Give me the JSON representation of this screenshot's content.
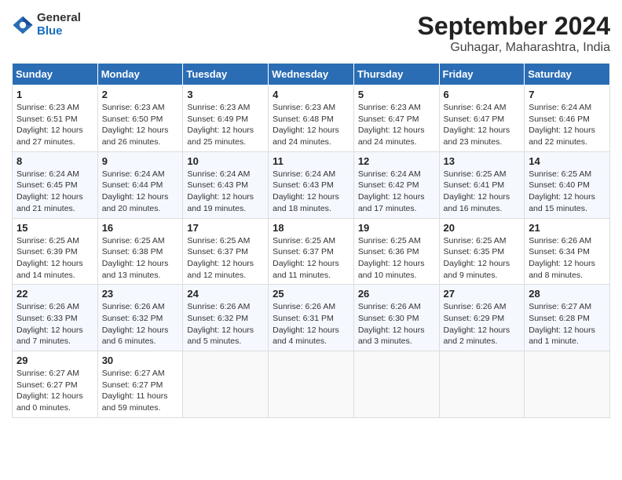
{
  "header": {
    "logo_general": "General",
    "logo_blue": "Blue",
    "main_title": "September 2024",
    "subtitle": "Guhagar, Maharashtra, India"
  },
  "weekdays": [
    "Sunday",
    "Monday",
    "Tuesday",
    "Wednesday",
    "Thursday",
    "Friday",
    "Saturday"
  ],
  "weeks": [
    [
      {
        "day": "1",
        "info": "Sunrise: 6:23 AM\nSunset: 6:51 PM\nDaylight: 12 hours\nand 27 minutes."
      },
      {
        "day": "2",
        "info": "Sunrise: 6:23 AM\nSunset: 6:50 PM\nDaylight: 12 hours\nand 26 minutes."
      },
      {
        "day": "3",
        "info": "Sunrise: 6:23 AM\nSunset: 6:49 PM\nDaylight: 12 hours\nand 25 minutes."
      },
      {
        "day": "4",
        "info": "Sunrise: 6:23 AM\nSunset: 6:48 PM\nDaylight: 12 hours\nand 24 minutes."
      },
      {
        "day": "5",
        "info": "Sunrise: 6:23 AM\nSunset: 6:47 PM\nDaylight: 12 hours\nand 24 minutes."
      },
      {
        "day": "6",
        "info": "Sunrise: 6:24 AM\nSunset: 6:47 PM\nDaylight: 12 hours\nand 23 minutes."
      },
      {
        "day": "7",
        "info": "Sunrise: 6:24 AM\nSunset: 6:46 PM\nDaylight: 12 hours\nand 22 minutes."
      }
    ],
    [
      {
        "day": "8",
        "info": "Sunrise: 6:24 AM\nSunset: 6:45 PM\nDaylight: 12 hours\nand 21 minutes."
      },
      {
        "day": "9",
        "info": "Sunrise: 6:24 AM\nSunset: 6:44 PM\nDaylight: 12 hours\nand 20 minutes."
      },
      {
        "day": "10",
        "info": "Sunrise: 6:24 AM\nSunset: 6:43 PM\nDaylight: 12 hours\nand 19 minutes."
      },
      {
        "day": "11",
        "info": "Sunrise: 6:24 AM\nSunset: 6:43 PM\nDaylight: 12 hours\nand 18 minutes."
      },
      {
        "day": "12",
        "info": "Sunrise: 6:24 AM\nSunset: 6:42 PM\nDaylight: 12 hours\nand 17 minutes."
      },
      {
        "day": "13",
        "info": "Sunrise: 6:25 AM\nSunset: 6:41 PM\nDaylight: 12 hours\nand 16 minutes."
      },
      {
        "day": "14",
        "info": "Sunrise: 6:25 AM\nSunset: 6:40 PM\nDaylight: 12 hours\nand 15 minutes."
      }
    ],
    [
      {
        "day": "15",
        "info": "Sunrise: 6:25 AM\nSunset: 6:39 PM\nDaylight: 12 hours\nand 14 minutes."
      },
      {
        "day": "16",
        "info": "Sunrise: 6:25 AM\nSunset: 6:38 PM\nDaylight: 12 hours\nand 13 minutes."
      },
      {
        "day": "17",
        "info": "Sunrise: 6:25 AM\nSunset: 6:37 PM\nDaylight: 12 hours\nand 12 minutes."
      },
      {
        "day": "18",
        "info": "Sunrise: 6:25 AM\nSunset: 6:37 PM\nDaylight: 12 hours\nand 11 minutes."
      },
      {
        "day": "19",
        "info": "Sunrise: 6:25 AM\nSunset: 6:36 PM\nDaylight: 12 hours\nand 10 minutes."
      },
      {
        "day": "20",
        "info": "Sunrise: 6:25 AM\nSunset: 6:35 PM\nDaylight: 12 hours\nand 9 minutes."
      },
      {
        "day": "21",
        "info": "Sunrise: 6:26 AM\nSunset: 6:34 PM\nDaylight: 12 hours\nand 8 minutes."
      }
    ],
    [
      {
        "day": "22",
        "info": "Sunrise: 6:26 AM\nSunset: 6:33 PM\nDaylight: 12 hours\nand 7 minutes."
      },
      {
        "day": "23",
        "info": "Sunrise: 6:26 AM\nSunset: 6:32 PM\nDaylight: 12 hours\nand 6 minutes."
      },
      {
        "day": "24",
        "info": "Sunrise: 6:26 AM\nSunset: 6:32 PM\nDaylight: 12 hours\nand 5 minutes."
      },
      {
        "day": "25",
        "info": "Sunrise: 6:26 AM\nSunset: 6:31 PM\nDaylight: 12 hours\nand 4 minutes."
      },
      {
        "day": "26",
        "info": "Sunrise: 6:26 AM\nSunset: 6:30 PM\nDaylight: 12 hours\nand 3 minutes."
      },
      {
        "day": "27",
        "info": "Sunrise: 6:26 AM\nSunset: 6:29 PM\nDaylight: 12 hours\nand 2 minutes."
      },
      {
        "day": "28",
        "info": "Sunrise: 6:27 AM\nSunset: 6:28 PM\nDaylight: 12 hours\nand 1 minute."
      }
    ],
    [
      {
        "day": "29",
        "info": "Sunrise: 6:27 AM\nSunset: 6:27 PM\nDaylight: 12 hours\nand 0 minutes."
      },
      {
        "day": "30",
        "info": "Sunrise: 6:27 AM\nSunset: 6:27 PM\nDaylight: 11 hours\nand 59 minutes."
      },
      null,
      null,
      null,
      null,
      null
    ]
  ]
}
